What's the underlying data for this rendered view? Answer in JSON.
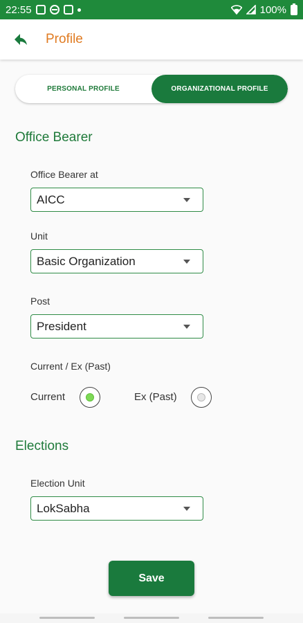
{
  "status_bar": {
    "time": "22:55",
    "battery": "100%"
  },
  "app_bar": {
    "title": "Profile"
  },
  "tabs": [
    {
      "label": "PERSONAL PROFILE",
      "active": false
    },
    {
      "label": "ORGANIZATIONAL PROFILE",
      "active": true
    }
  ],
  "office_bearer": {
    "section_title": "Office Bearer",
    "office_bearer_at": {
      "label": "Office Bearer at",
      "value": "AICC"
    },
    "unit": {
      "label": "Unit",
      "value": "Basic Organization"
    },
    "post": {
      "label": "Post",
      "value": "President"
    },
    "current_ex": {
      "label": "Current / Ex (Past)",
      "options": [
        {
          "label": "Current",
          "selected": true
        },
        {
          "label": "Ex (Past)",
          "selected": false
        }
      ]
    }
  },
  "elections": {
    "section_title": "Elections",
    "election_unit": {
      "label": "Election Unit",
      "value": "LokSabha"
    }
  },
  "save_button": {
    "label": "Save"
  },
  "colors": {
    "primary_green": "#1a7a3d",
    "title_orange": "#e07b22",
    "radio_selected": "#7ed957"
  }
}
